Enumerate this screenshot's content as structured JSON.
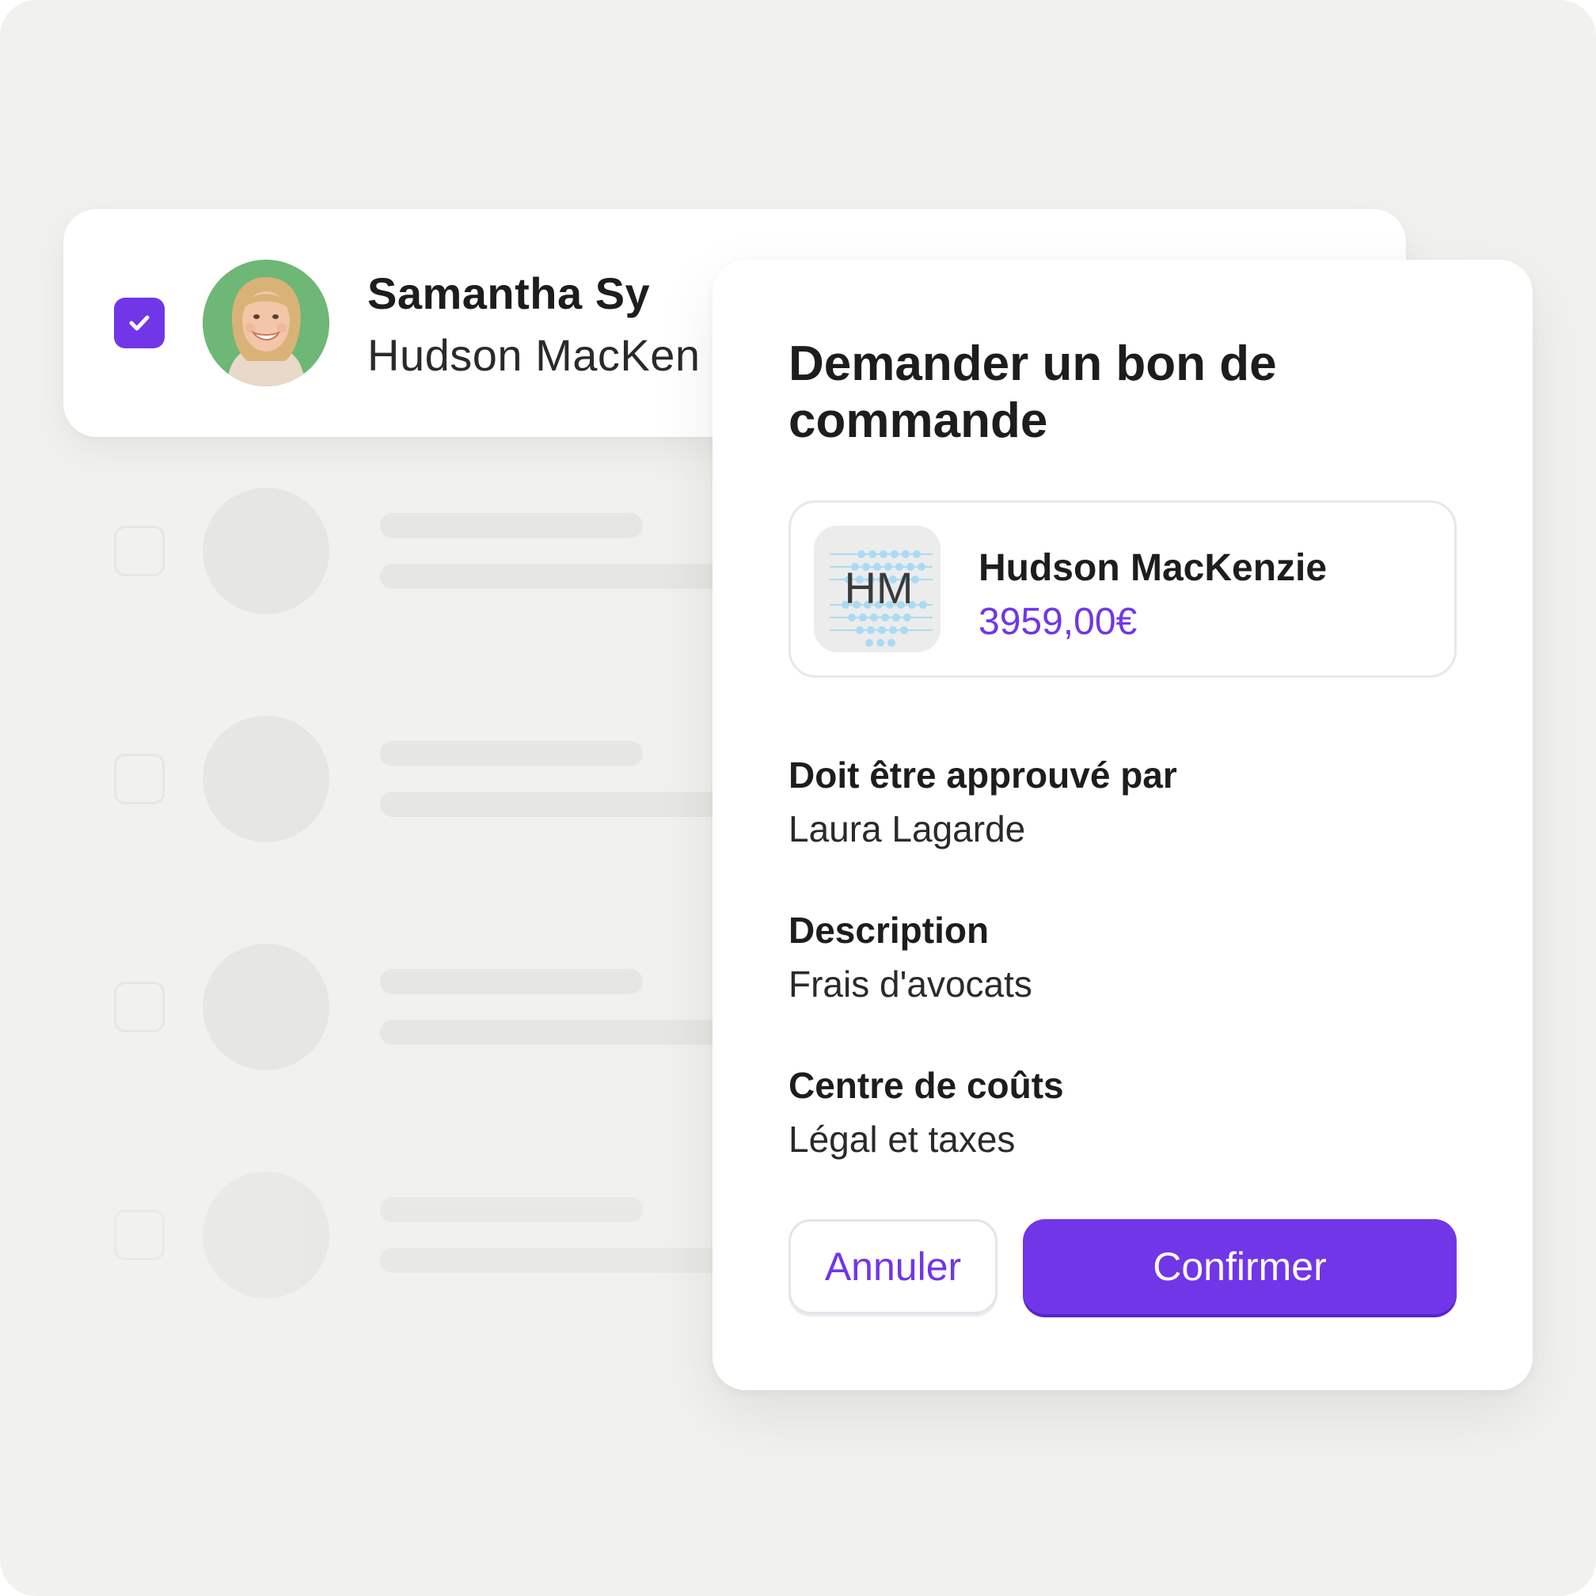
{
  "colors": {
    "background": "#f1f1ee",
    "accent": "#7136e7",
    "skeleton": "#e6e6e2",
    "card": "#ffffff"
  },
  "selected_row": {
    "checked": true,
    "avatar_icon": "person-avatar",
    "name": "Samantha Sy",
    "company": "Hudson MacKen"
  },
  "skeleton_rows": 4,
  "modal": {
    "title": "Demander un bon de commande",
    "supplier": {
      "logo_icon": "hm-logo",
      "logo_text": "HM",
      "name": "Hudson MacKenzie",
      "amount": "3959,00€"
    },
    "fields": [
      {
        "label": "Doit être approuvé par",
        "value": "Laura Lagarde"
      },
      {
        "label": "Description",
        "value": "Frais d'avocats"
      },
      {
        "label": "Centre de coûts",
        "value": "Légal et taxes"
      }
    ],
    "cancel_label": "Annuler",
    "confirm_label": "Confirmer"
  }
}
